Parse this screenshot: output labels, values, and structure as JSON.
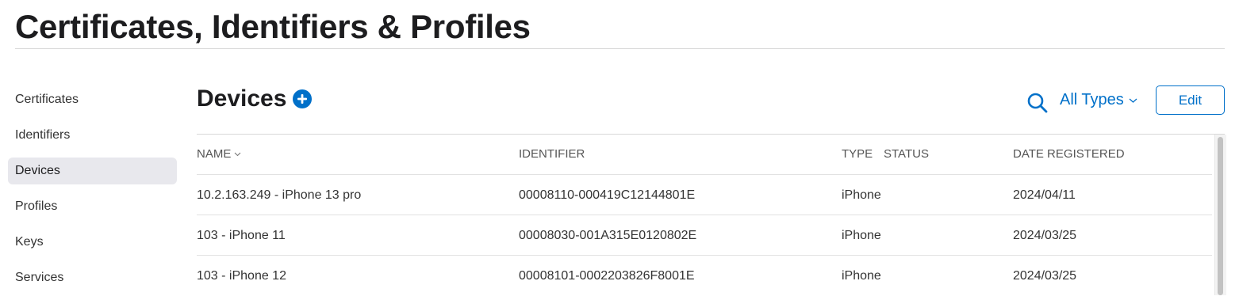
{
  "page": {
    "title": "Certificates, Identifiers & Profiles"
  },
  "sidebar": {
    "items": [
      {
        "label": "Certificates",
        "active": false
      },
      {
        "label": "Identifiers",
        "active": false
      },
      {
        "label": "Devices",
        "active": true
      },
      {
        "label": "Profiles",
        "active": false
      },
      {
        "label": "Keys",
        "active": false
      },
      {
        "label": "Services",
        "active": false
      }
    ]
  },
  "main": {
    "heading": "Devices",
    "add_icon": "plus-circle-icon",
    "search_icon": "search-icon",
    "filter": {
      "selected": "All Types",
      "icon": "chevron-down-icon"
    },
    "edit_label": "Edit"
  },
  "table": {
    "columns": [
      "NAME",
      "IDENTIFIER",
      "TYPE",
      "STATUS",
      "DATE REGISTERED"
    ],
    "sort_icon": "chevron-down-icon",
    "rows": [
      {
        "name": "10.2.163.249 - iPhone 13 pro",
        "identifier": "00008110-000419C12144801E",
        "type": "iPhone",
        "status": "",
        "date": "2024/04/11"
      },
      {
        "name": "103 - iPhone 11",
        "identifier": "00008030-001A315E0120802E",
        "type": "iPhone",
        "status": "",
        "date": "2024/03/25"
      },
      {
        "name": "103 - iPhone 12",
        "identifier": "00008101-0002203826F8001E",
        "type": "iPhone",
        "status": "",
        "date": "2024/03/25"
      }
    ]
  },
  "colors": {
    "accent": "#0070c9",
    "active_bg": "#e8e8ed",
    "rule": "#d8d8d8"
  }
}
